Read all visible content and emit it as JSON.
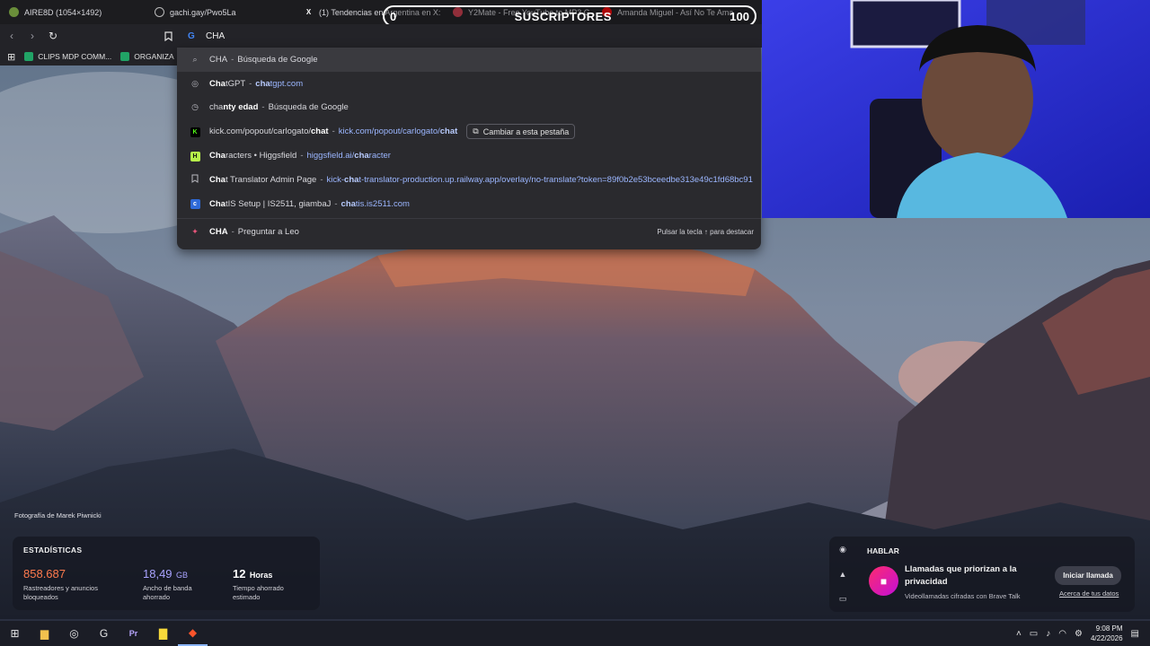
{
  "tabs": [
    {
      "title": "AIRE8D (1054×1492)",
      "icon": "image-icon"
    },
    {
      "title": "gachi.gay/Pwo5La",
      "icon": "globe-icon"
    },
    {
      "title": "(1) Tendencias en Argentina en X: ",
      "icon": "x-logo-icon"
    },
    {
      "title": "Y2Mate - Free YouTube to MP3 C",
      "icon": "y2mate-icon"
    },
    {
      "title": "Amanda Miguel - Así No Te Ama",
      "icon": "youtube-icon"
    }
  ],
  "overlay": {
    "left_count": "0",
    "label": "SUSCRIPTORES",
    "right_count": "100"
  },
  "omnibox": {
    "value": "CHA"
  },
  "bookmarks": [
    {
      "label": "CLIPS MDP COMM..."
    },
    {
      "label": "ORGANIZA"
    }
  ],
  "suggestions": [
    {
      "icon": "search-icon",
      "bold": "CHA",
      "rest": "",
      "sep": "-",
      "tail": "Búsqueda de Google",
      "tail_is_url": false
    },
    {
      "icon": "openai-icon",
      "bold": "Cha",
      "rest": "tGPT",
      "sep": "-",
      "url_bold": "cha",
      "url_rest": "tgpt.com"
    },
    {
      "icon": "history-icon",
      "bold": "",
      "pre": "cha",
      "rest_bold": "nty edad",
      "sep": "-",
      "tail": "Búsqueda de Google"
    },
    {
      "icon": "kick-icon",
      "text": "kick.com/popout/carlogato/",
      "text_bold": "chat",
      "sep": "-",
      "url": "kick.com/popout/carlogato/",
      "url_bold": "chat",
      "button": "Cambiar a esta pestaña"
    },
    {
      "icon": "higgsfield-icon",
      "bold": "Cha",
      "rest": "racters • Higgsfield",
      "sep": "-",
      "url": "higgsfield.ai/",
      "url_bold": "cha",
      "url_rest": "racter"
    },
    {
      "icon": "bookmark-icon",
      "bold": "Cha",
      "rest": "t Translator Admin Page",
      "sep": "-",
      "url": "kick-",
      "url_bold": "cha",
      "url_rest": "t-translator-production.up.railway.app/overlay/no-translate?token=89f0b2e53bceedbe313e49c1fd68bc91"
    },
    {
      "icon": "chatis-icon",
      "bold": "Cha",
      "rest": "tIS Setup | IS2511, giambaJ",
      "sep": "-",
      "url_bold": "cha",
      "url_rest": "tis.is2511.com"
    },
    {
      "icon": "leo-icon",
      "bold": "CHA",
      "sep": "-",
      "tail": "Preguntar a Leo",
      "hint": "Pulsar la tecla ↑ para destacar"
    }
  ],
  "photo_credit": "Fotografía de Marek Piwnicki",
  "stats": {
    "title": "ESTADÍSTICAS",
    "items": [
      {
        "value": "858.687",
        "unit": "",
        "desc1": "Rastreadores y anuncios",
        "desc2": "bloqueados",
        "color": "#ff7a4d"
      },
      {
        "value": "18,49",
        "unit": "GB",
        "desc1": "Ancho de banda",
        "desc2": "ahorrado",
        "color": "#a9a3ff"
      },
      {
        "value": "12",
        "unit": "Horas",
        "desc1": "Tiempo ahorrado",
        "desc2": "estimado",
        "color": "#ffffff"
      }
    ]
  },
  "talk": {
    "title": "HABLAR",
    "headline": "Llamadas que priorizan a la privacidad",
    "sub": "Videollamadas cifradas con Brave Talk",
    "button": "Iniciar llamada",
    "link": "Acerca de tus datos"
  },
  "clock": {
    "time": "9:08 PM",
    "date": "4/22/2026"
  }
}
